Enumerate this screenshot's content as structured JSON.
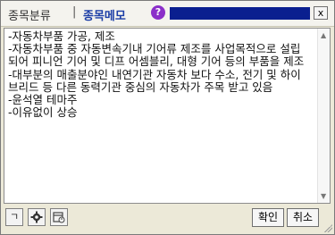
{
  "titlebar": {
    "tab_category": "종목분류",
    "separator": "|",
    "tab_memo": "종목메모",
    "help_label": "?",
    "close_label": "x",
    "accent_color": "#0a1f8f"
  },
  "memo": {
    "text": "-자동차부품 가공, 제조\n-자동차부품 중 자동변속기내 기어류 제조를 사업목적으로 설립되어 피니언 기어 및 디프 어셈블리, 대형 기어 등의 부품을 제조\n-대부분의 매출분야인 내연기관 자동차 보다 수소, 전기 및 하이브리드 등 다른 동력기관 중심의 자동차가 주목 받고 있음\n-윤석열 테마주\n-이유없이 상승"
  },
  "toolbar": {
    "icon1_label": "ㄱ",
    "icon2": "gear-icon",
    "icon3": "calendar-icon",
    "confirm_label": "확인",
    "cancel_label": "취소"
  }
}
